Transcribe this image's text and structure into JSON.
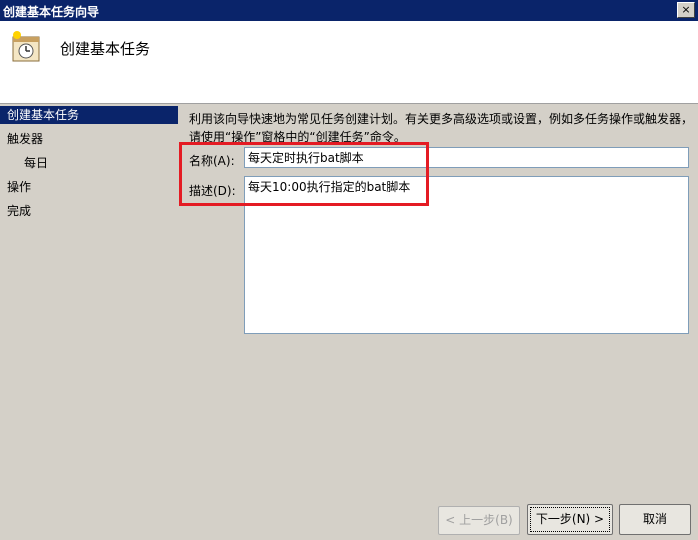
{
  "window": {
    "title": "创建基本任务向导",
    "close_label": "×"
  },
  "header": {
    "title": "创建基本任务",
    "icon": "task-clock-icon"
  },
  "sidebar": {
    "items": [
      {
        "label": "创建基本任务",
        "active": true
      },
      {
        "label": "触发器"
      },
      {
        "label": "每日"
      },
      {
        "label": "操作"
      },
      {
        "label": "完成"
      }
    ]
  },
  "main": {
    "description": "利用该向导快速地为常见任务创建计划。有关更多高级选项或设置，例如多任务操作或触发器，请使用“操作”窗格中的“创建任务”命令。",
    "name_label": "名称(A):",
    "name_value": "每天定时执行bat脚本",
    "desc_label": "描述(D):",
    "desc_value": "每天10:00执行指定的bat脚本"
  },
  "buttons": {
    "back": "< 上一步(B)",
    "next": "下一步(N) >",
    "cancel": "取消"
  },
  "colors": {
    "title_bg": "#0a246a",
    "highlight": "#e41b23"
  }
}
